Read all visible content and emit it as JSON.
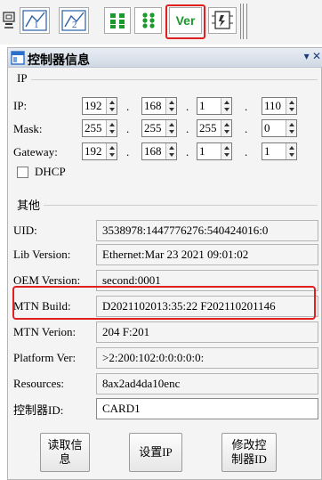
{
  "toolbar": {
    "ver_label": "Ver",
    "icons": [
      "network-card-icon",
      "chart-1-icon",
      "chart-2-icon",
      "grid-icon",
      "dots-icon",
      "ver-icon",
      "device-icon"
    ]
  },
  "panel": {
    "title": "控制器信息",
    "pin_symbol": "▾",
    "close_symbol": "✕",
    "ip_group": {
      "title": "IP",
      "ip_label": "IP:",
      "mask_label": "Mask:",
      "gateway_label": "Gateway:",
      "ip": [
        "192",
        "168",
        "1",
        "110"
      ],
      "mask": [
        "255",
        "255",
        "255",
        "0"
      ],
      "gateway": [
        "192",
        "168",
        "1",
        "1"
      ],
      "dhcp_label": "DHCP",
      "dhcp_checked": false
    },
    "other_group": {
      "title": "其他",
      "uid_label": "UID:",
      "uid_value": "3538978:1447776276:540424016:0",
      "lib_label": "Lib Version:",
      "lib_value": "Ethernet:Mar 23 2021 09:01:02",
      "oem_label": "OEM Version:",
      "oem_value": "second:0001",
      "mtn_build_label": "MTN Build:",
      "mtn_build_value": "D2021102013:35:22 F202110201146",
      "mtn_verion_label": "MTN Verion:",
      "mtn_verion_value": "204 F:201",
      "platform_label": "Platform Ver:",
      "platform_value": ">2:200:102:0:0:0:0:0:",
      "resources_label": "Resources:",
      "resources_value": "8ax2ad4da10enc",
      "controller_id_label": "控制器ID:",
      "controller_id_value": "CARD1"
    },
    "buttons": {
      "read_info_line1": "读取信",
      "read_info_line2": "息",
      "set_ip": "设置IP",
      "modify_id_line1": "修改控",
      "modify_id_line2": "制器ID"
    }
  },
  "colors": {
    "highlight": "#e02020",
    "ver_text": "#1a9a2a"
  }
}
